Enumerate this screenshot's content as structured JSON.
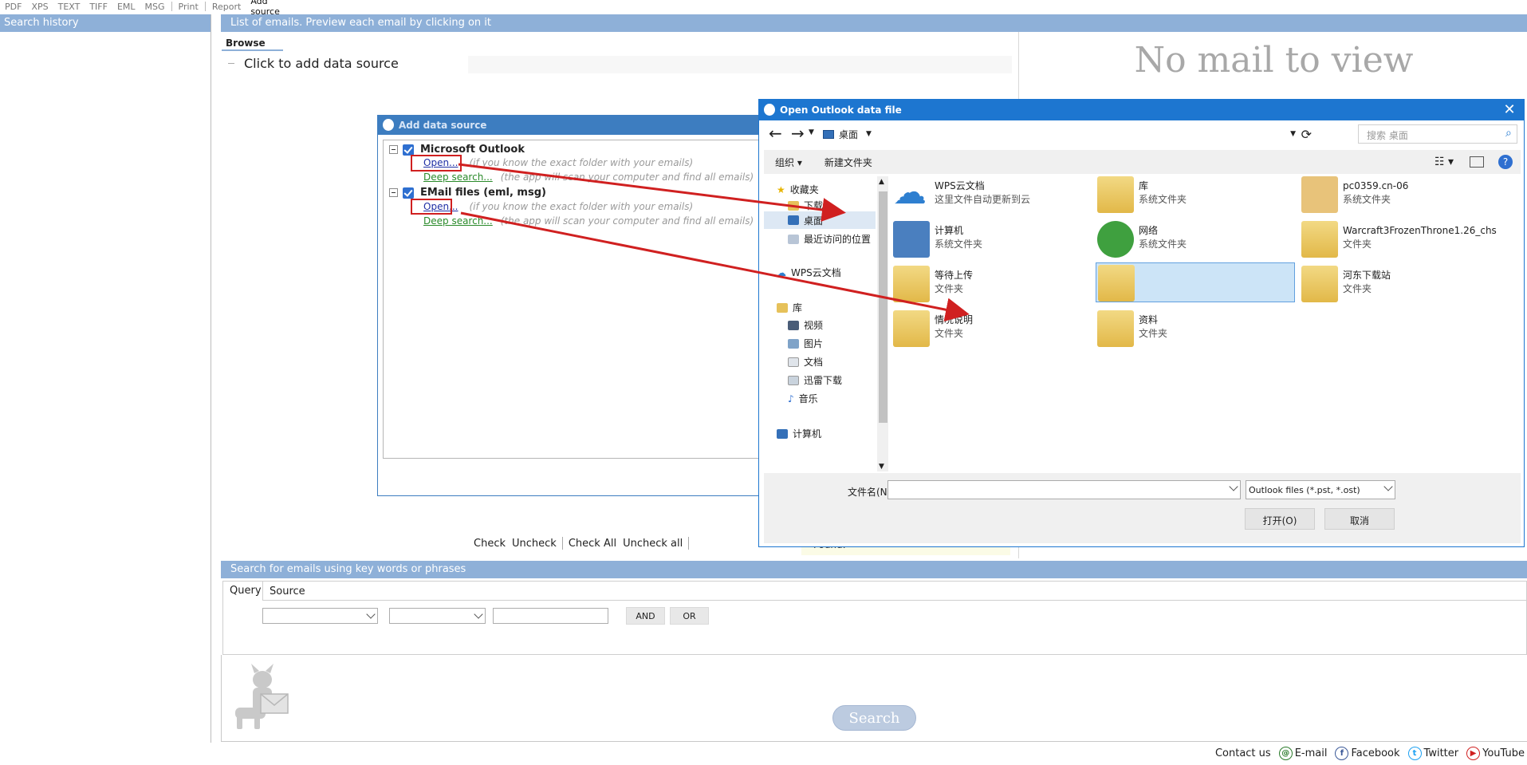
{
  "toolbar": {
    "items": [
      "PDF",
      "XPS",
      "TEXT",
      "TIFF",
      "EML",
      "MSG",
      "Print",
      "Report",
      "Add source"
    ]
  },
  "left_panel": {
    "header": "Search history"
  },
  "list": {
    "header": "List of emails. Preview each email by clicking on it",
    "browse_tab": "Browse",
    "add_data_source": "Click to add data source",
    "no_mail": "No mail to view"
  },
  "check_bar": {
    "check": "Check",
    "uncheck": "Uncheck",
    "check_all": "Check All",
    "uncheck_all": "Uncheck all",
    "found": "Found:"
  },
  "search": {
    "header": "Search for emails using key words or phrases",
    "tab_query": "Query",
    "tab_source": "Source",
    "and_label": "AND",
    "or_label": "OR",
    "search_label": "Search"
  },
  "footer": {
    "contact": "Contact us",
    "email": "E-mail",
    "facebook": "Facebook",
    "twitter": "Twitter",
    "youtube": "YouTube"
  },
  "add_source_dialog": {
    "title": "Add data source",
    "outlook_title": "Microsoft Outlook",
    "outlook_open": "Open...",
    "outlook_open_hint": "(if you know the exact folder with your emails)",
    "outlook_deep": "Deep search...",
    "outlook_deep_hint": "(the app will scan your computer and find all emails)",
    "files_title": "EMail files (eml, msg)",
    "files_open": "Open...",
    "files_open_hint": "(if you know the exact folder with your emails)",
    "files_deep": "Deep search...",
    "files_deep_hint": "(the app will scan your computer and find all emails)"
  },
  "open_dialog": {
    "title": "Open Outlook data file",
    "address": "桌面",
    "search_placeholder": "搜索 桌面",
    "organize": "组织",
    "new_folder": "新建文件夹",
    "sidebar": {
      "favorites": "收藏夹",
      "downloads": "下载",
      "desktop": "桌面",
      "recent": "最近访问的位置",
      "wps": "WPS云文档",
      "libraries": "库",
      "videos": "视频",
      "pictures": "图片",
      "documents": "文档",
      "thunder": "迅雷下载",
      "music": "音乐",
      "computer": "计算机"
    },
    "items": [
      {
        "name": "WPS云文档",
        "sub": "这里文件自动更新到云"
      },
      {
        "name": "库",
        "sub": "系统文件夹"
      },
      {
        "name": "pc0359.cn-06",
        "sub": "系统文件夹"
      },
      {
        "name": "计算机",
        "sub": "系统文件夹"
      },
      {
        "name": "网络",
        "sub": "系统文件夹"
      },
      {
        "name": "Warcraft3FrozenThrone1.26_chs",
        "sub": "文件夹"
      },
      {
        "name": "等待上传",
        "sub": "文件夹"
      },
      {
        "name": "",
        "sub": ""
      },
      {
        "name": "河东下载站",
        "sub": "文件夹"
      },
      {
        "name": "情况说明",
        "sub": "文件夹"
      },
      {
        "name": "资料",
        "sub": "文件夹"
      }
    ],
    "filename_label": "文件名(N):",
    "filetype": "Outlook files (*.pst, *.ost)",
    "open_label": "打开(O)",
    "cancel_label": "取消"
  },
  "colors": {
    "header_blue": "#8eb0d8",
    "dialog_blue": "#1d76d0",
    "arrow_red": "#d02020"
  }
}
